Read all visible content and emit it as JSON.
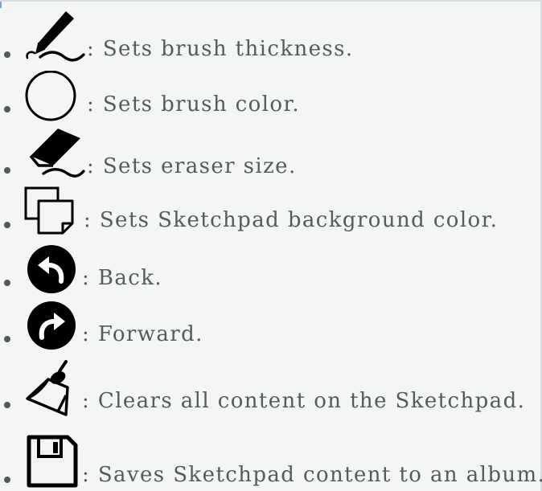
{
  "items": [
    {
      "icon": "pencil-stroke-icon",
      "text": ": Sets brush thickness."
    },
    {
      "icon": "circle-outline-icon",
      "text": ": Sets brush color."
    },
    {
      "icon": "eraser-stroke-icon",
      "text": ": Sets eraser size."
    },
    {
      "icon": "stacked-pages-icon",
      "text": ": Sets Sketchpad background color."
    },
    {
      "icon": "undo-arrow-icon",
      "text": ": Back."
    },
    {
      "icon": "redo-arrow-icon",
      "text": ": Forward."
    },
    {
      "icon": "broom-clear-icon",
      "text": ": Clears all content on the Sketchpad."
    },
    {
      "icon": "save-floppy-icon",
      "text": ": Saves Sketchpad content to an album."
    }
  ]
}
